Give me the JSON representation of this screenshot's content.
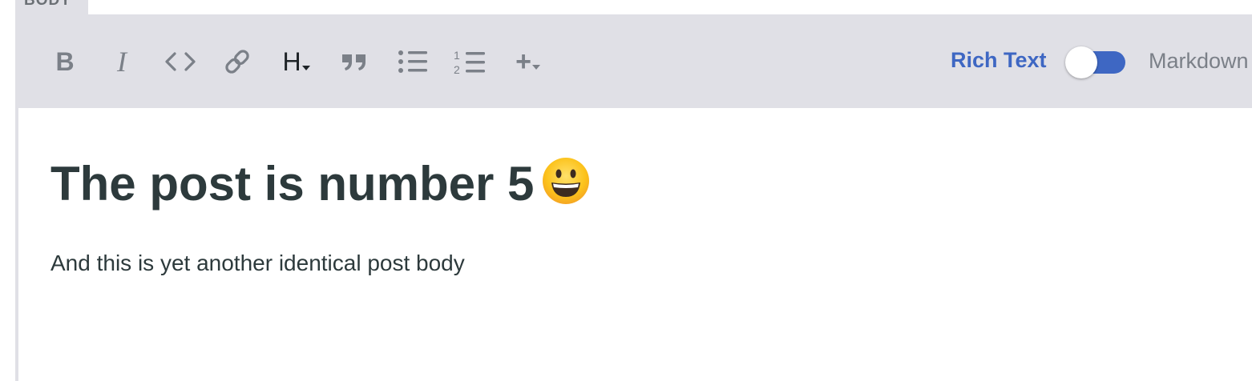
{
  "section_label": "BODY",
  "toolbar": {
    "bold_glyph": "B",
    "italic_glyph": "I",
    "heading_glyph": "H",
    "add_glyph": "+",
    "numbered_list_digits": [
      "1",
      "2"
    ],
    "icons": [
      "bold-icon",
      "italic-icon",
      "code-icon",
      "link-icon",
      "heading-icon",
      "quote-icon",
      "bulleted-list-icon",
      "numbered-list-icon",
      "insert-icon"
    ]
  },
  "mode": {
    "left_label": "Rich Text",
    "right_label": "Markdown",
    "active": "Rich Text"
  },
  "post": {
    "title": "The post is number 5",
    "title_emoji": "grinning-face",
    "body": "And this is yet another identical post body"
  },
  "colors": {
    "toolbar_bg": "#e0e0e6",
    "accent": "#3e67c3",
    "icon_gray": "#7b8088",
    "text_dark": "#2d3a3c"
  }
}
